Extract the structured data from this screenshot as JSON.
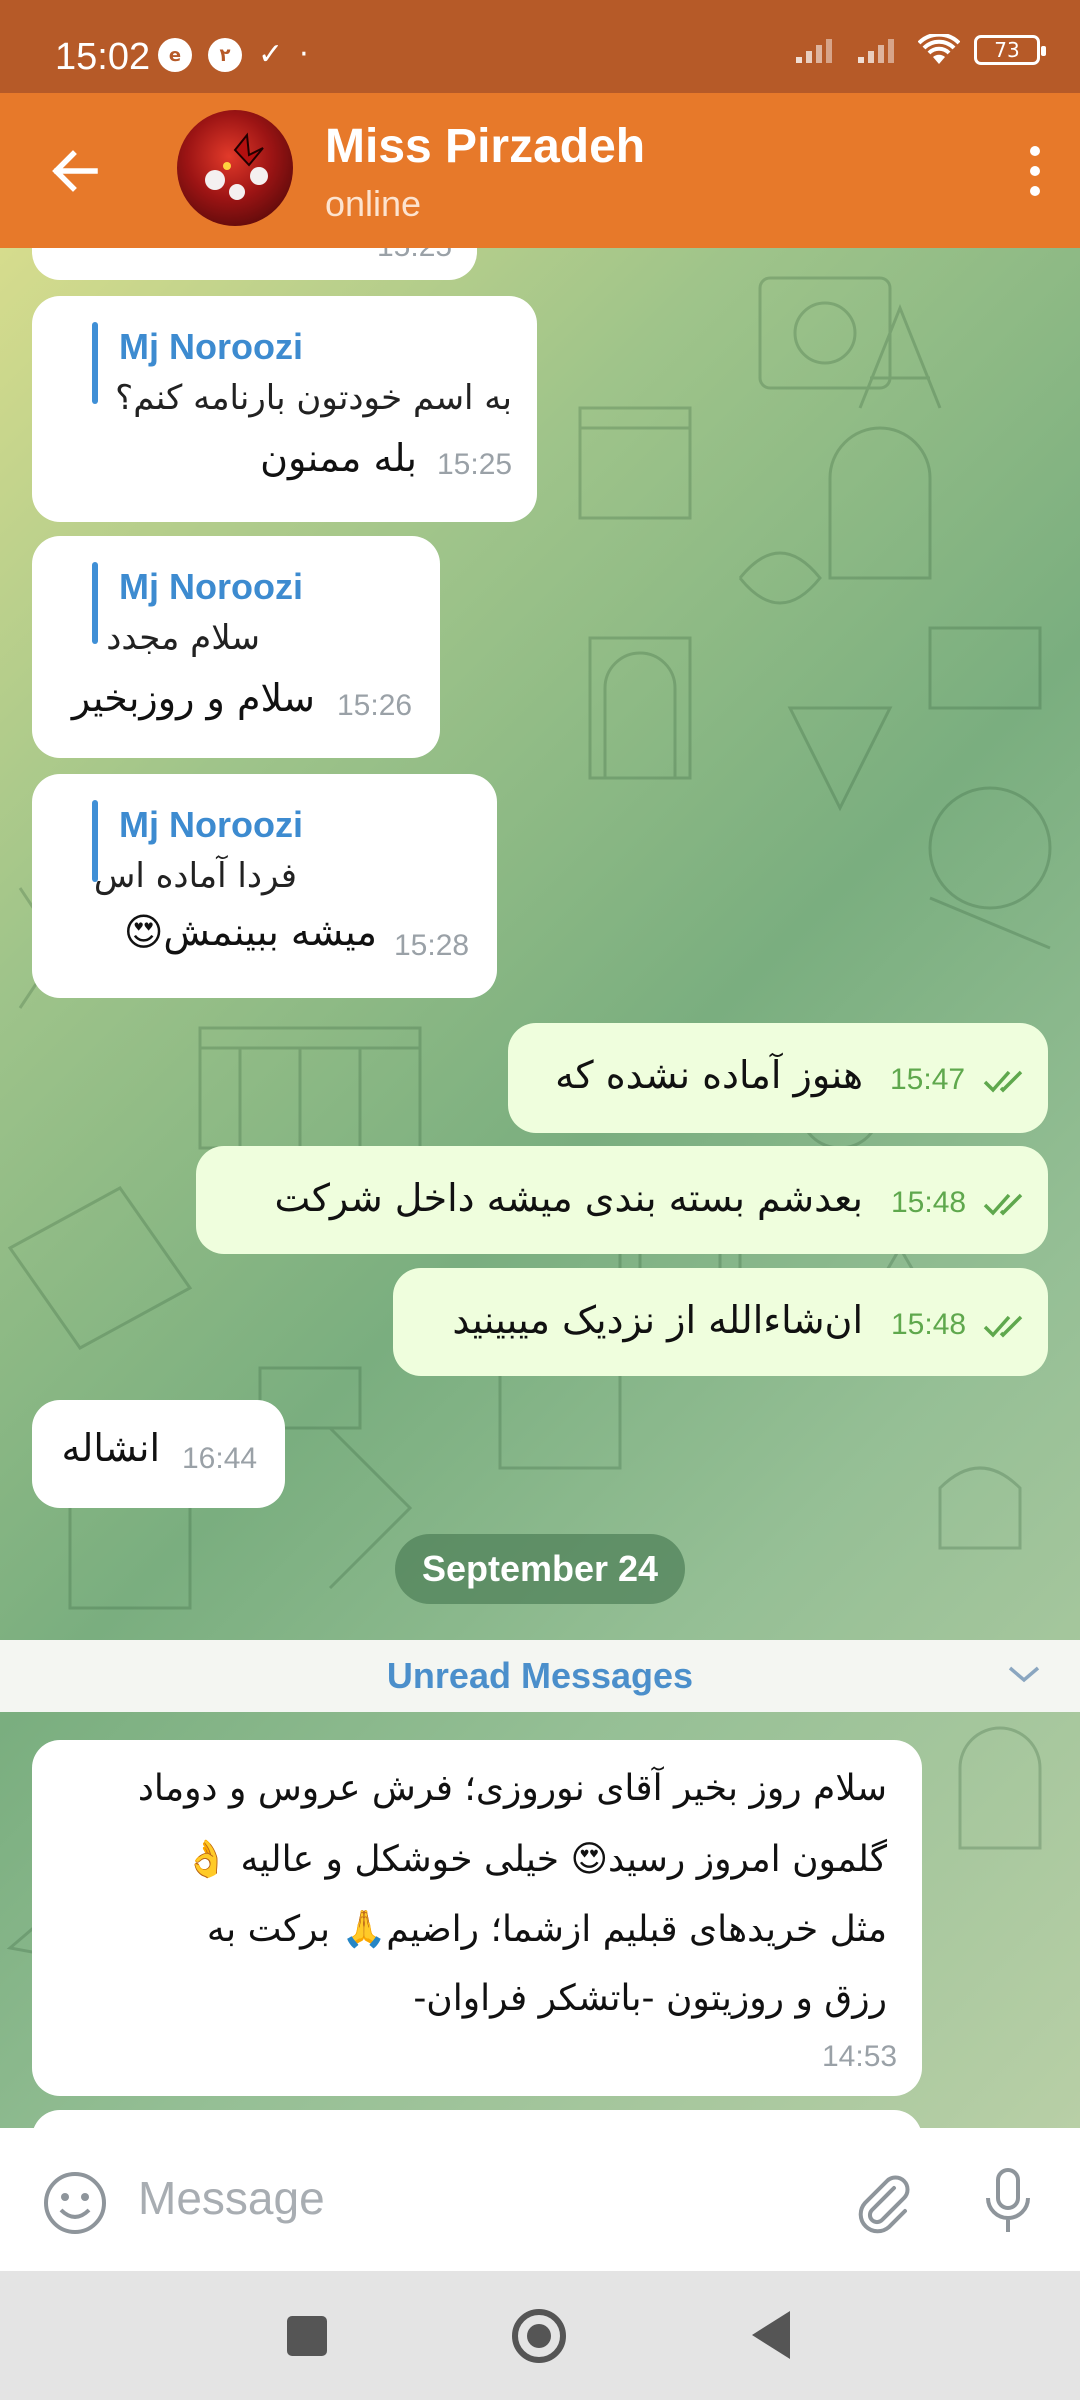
{
  "status_bar": {
    "time": "15:02",
    "badge_number": "٢",
    "battery": "73"
  },
  "header": {
    "title": "Miss Pirzadeh",
    "status": "online"
  },
  "messages": [
    {
      "direction": "in",
      "reply_name": "Mj Noroozi",
      "reply_text": "به اسم خودتون بارنامه کنم؟",
      "text": "بله ممنون",
      "time": "15:25"
    },
    {
      "direction": "in",
      "reply_name": "Mj Noroozi",
      "reply_text": "سلام مجدد",
      "text": "سلام و روزبخیر",
      "time": "15:26"
    },
    {
      "direction": "in",
      "reply_name": "Mj Noroozi",
      "reply_text": "فردا آماده اس",
      "text": "میشه ببینمش😍",
      "time": "15:28"
    },
    {
      "direction": "out",
      "text": "هنوز آماده نشده که",
      "time": "15:47"
    },
    {
      "direction": "out",
      "text": "بعدشم بسته بندی میشه داخل شرکت",
      "time": "15:48"
    },
    {
      "direction": "out",
      "text": "ان‌شاءالله از نزدیک میبینید",
      "time": "15:48"
    },
    {
      "direction": "in",
      "text": "انشاله",
      "time": "16:44"
    }
  ],
  "partial_top_time": "15:25",
  "date_separator": "September 24",
  "unread_label": "Unread Messages",
  "long_message": {
    "lines": [
      "سلام روز بخیر آقای نوروزی؛ فرش عروس و دوماد",
      "گلمون امروز رسید😍 خیلی خوشکل و عالیه 👌",
      "مثل خریدهای قبلیم ازشما؛ راضیم🙏 برکت به",
      "رزق و روزیتون -باتشکر فراوان-"
    ],
    "time": "14:53"
  },
  "input": {
    "placeholder": "Message"
  },
  "icons": {
    "back": "arrow-left-icon",
    "menu": "more-vertical-icon",
    "emoji": "emoji-icon",
    "attach": "paperclip-icon",
    "mic": "microphone-icon"
  },
  "colors": {
    "header": "#e7792a",
    "status_bar": "#b65a28",
    "outgoing_bubble": "#effedd",
    "link_blue": "#3d8bd0"
  }
}
